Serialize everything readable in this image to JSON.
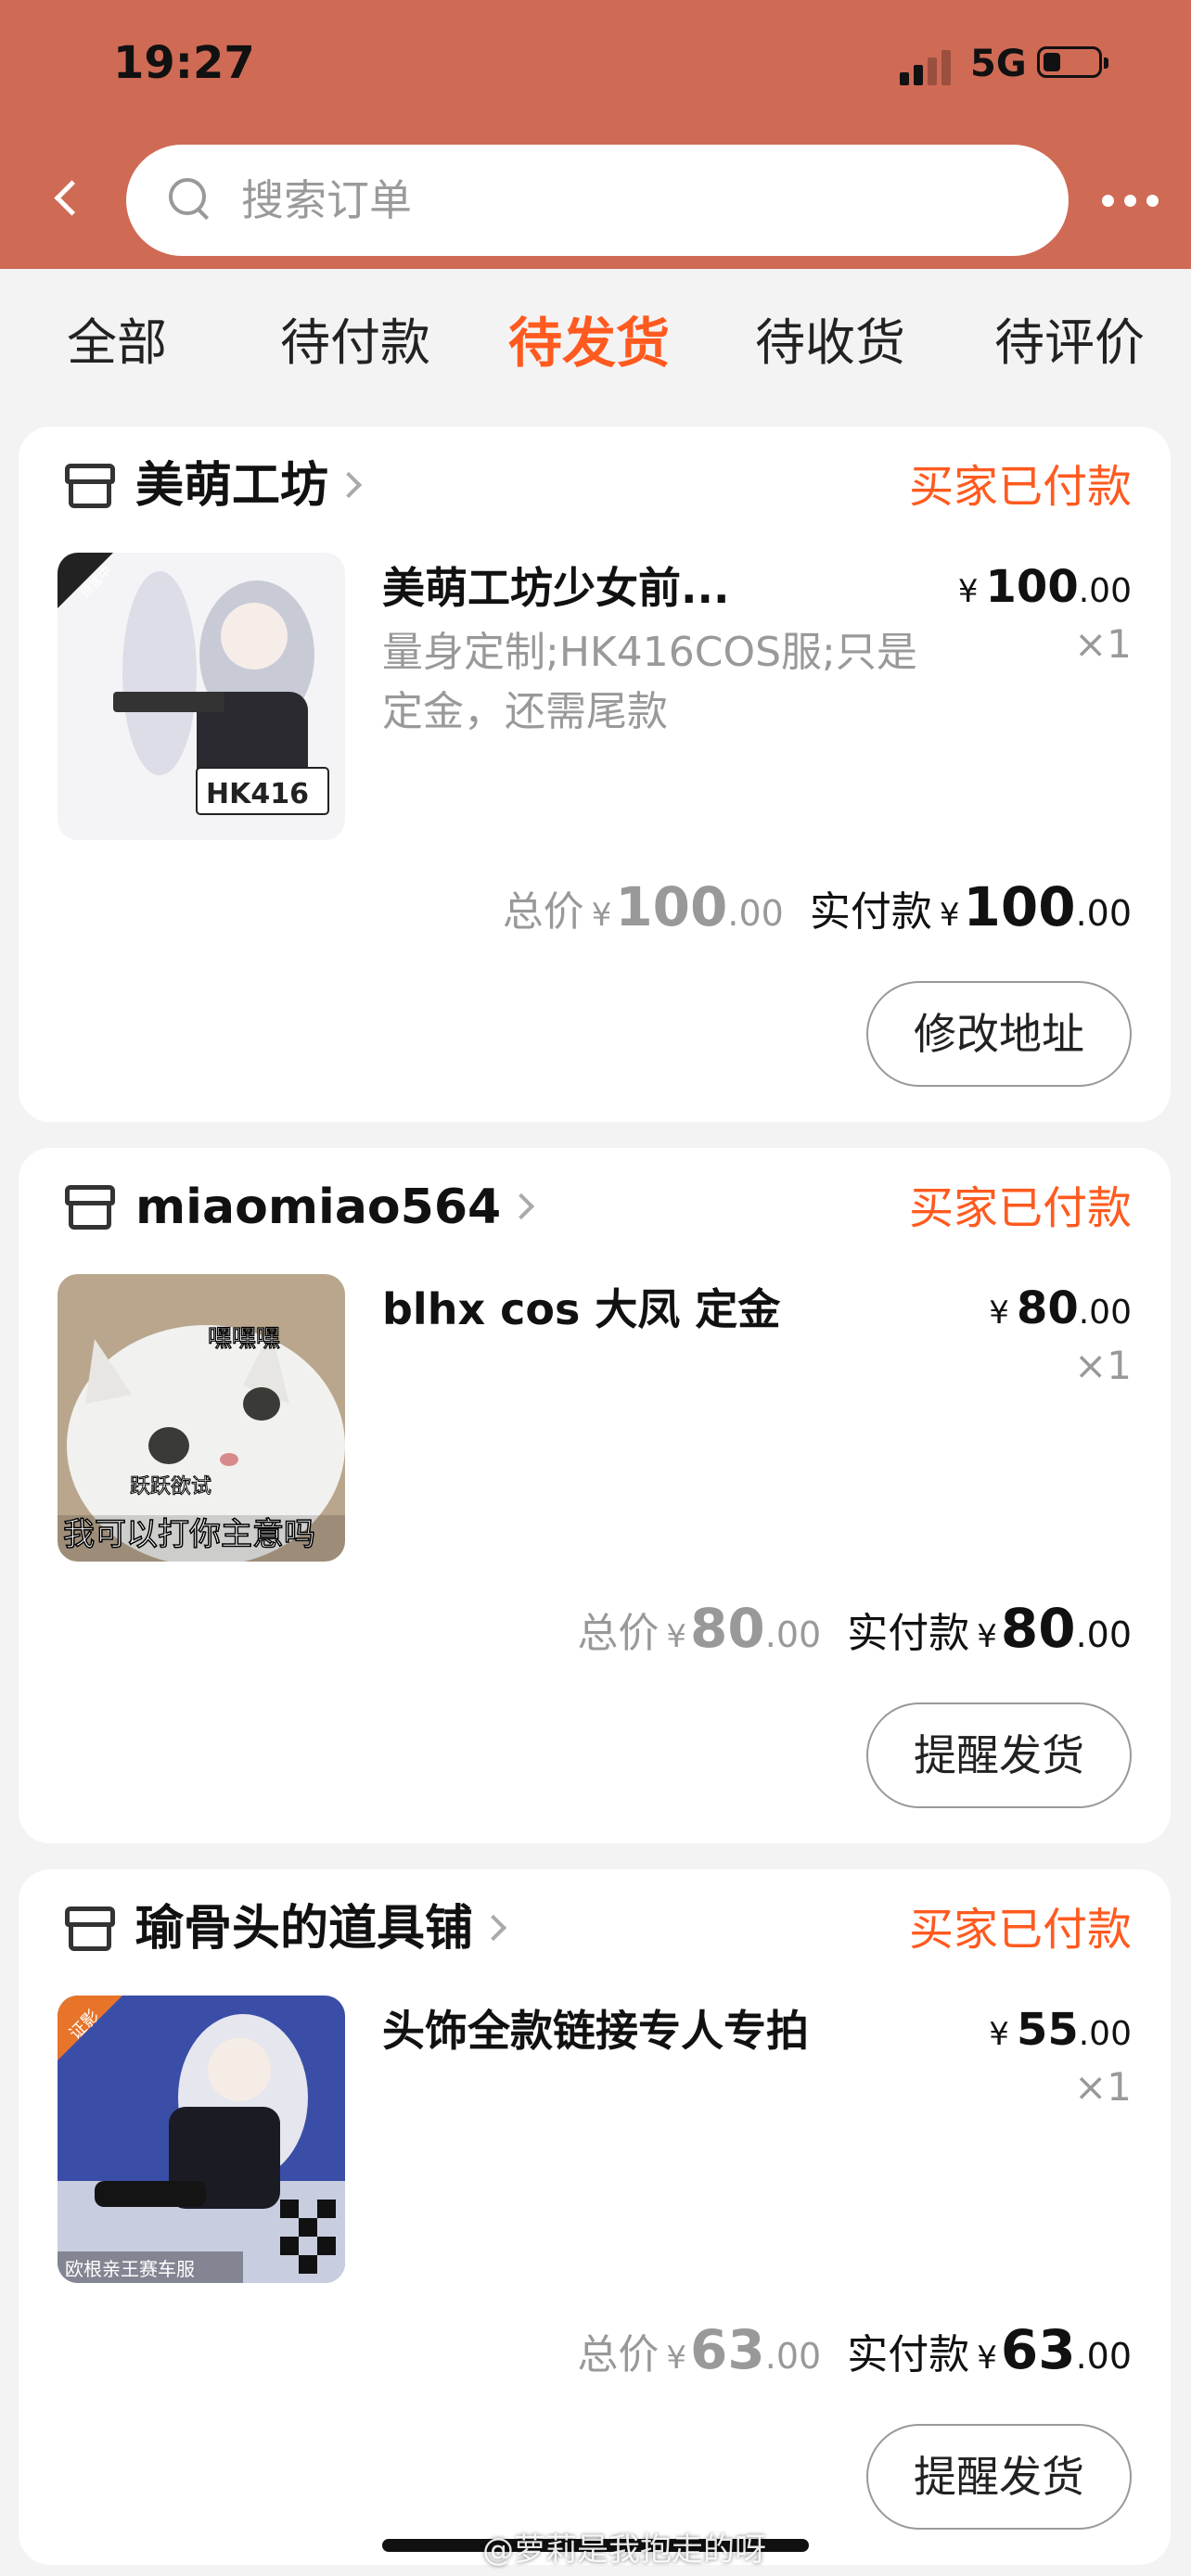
{
  "status_bar": {
    "time": "19:27",
    "network": "5G"
  },
  "header": {
    "search_placeholder": "搜索订单"
  },
  "tabs": [
    {
      "label": "全部"
    },
    {
      "label": "待付款"
    },
    {
      "label": "待发货",
      "active": true
    },
    {
      "label": "待收货"
    },
    {
      "label": "待评价"
    }
  ],
  "orders": [
    {
      "shop": "美萌工坊",
      "status": "买家已付款",
      "title": "美萌工坊少女前...",
      "spec": "量身定制;HK416COS服;只是定金，还需尾款",
      "thumb_text": "HK416",
      "thumb_tag": "预售中",
      "price_int": "100",
      "price_dec": ".00",
      "qty": "×1",
      "total_label": "总价",
      "total_int": "100",
      "total_dec": ".00",
      "paid_label": "实付款",
      "paid_int": "100",
      "paid_dec": ".00",
      "action": "修改地址"
    },
    {
      "shop": "miaomiao564",
      "status": "买家已付款",
      "title": "blhx cos 大凤 定金",
      "spec": "",
      "thumb_text": "我可以打你主意吗",
      "thumb_text2": "嘿嘿嘿",
      "thumb_text3": "跃跃欲试",
      "price_int": "80",
      "price_dec": ".00",
      "qty": "×1",
      "total_label": "总价",
      "total_int": "80",
      "total_dec": ".00",
      "paid_label": "实付款",
      "paid_int": "80",
      "paid_dec": ".00",
      "action": "提醒发货"
    },
    {
      "shop": "瑜骨头的道具铺",
      "status": "买家已付款",
      "title": "头饰全款链接专人专拍",
      "spec": "",
      "thumb_text": "欧根亲王赛车服",
      "thumb_tag": "证影",
      "price_int": "55",
      "price_dec": ".00",
      "qty": "×1",
      "total_label": "总价",
      "total_int": "63",
      "total_dec": ".00",
      "paid_label": "实付款",
      "paid_int": "63",
      "paid_dec": ".00",
      "action": "提醒发货"
    }
  ],
  "currency": "¥",
  "watermark": "@萝莉是我抱走的呀",
  "colors": {
    "header": "#cf6a55",
    "accent": "#ff5a1f",
    "background": "#f3f3f3"
  }
}
